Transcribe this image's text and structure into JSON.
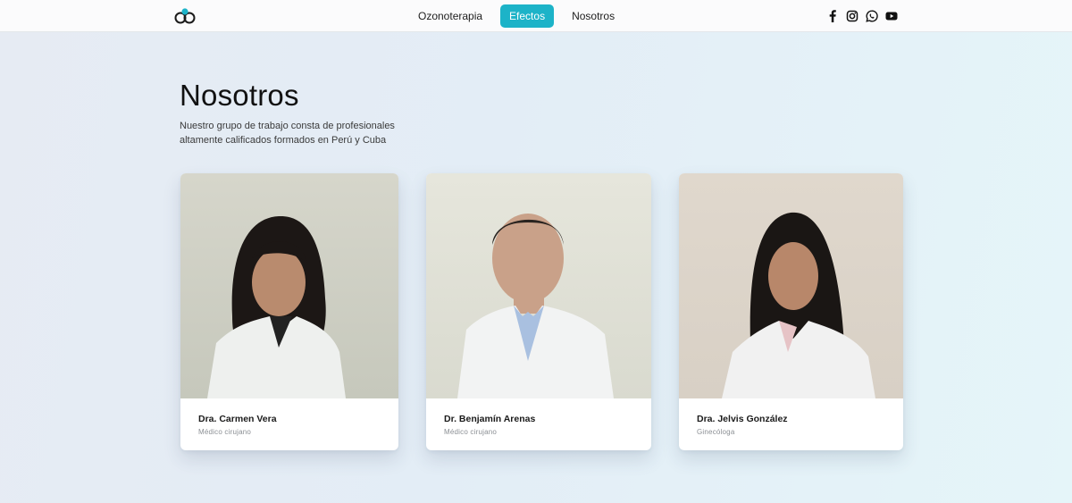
{
  "header": {
    "logo": "logo-icon",
    "nav": [
      {
        "label": "Ozonoterapia",
        "active": false
      },
      {
        "label": "Efectos",
        "active": true
      },
      {
        "label": "Nosotros",
        "active": false
      }
    ],
    "social": [
      "facebook-icon",
      "instagram-icon",
      "whatsapp-icon",
      "youtube-icon"
    ],
    "accent_color": "#1cb3c8"
  },
  "main": {
    "title": "Nosotros",
    "subtitle": "Nuestro grupo de trabajo consta de profesionales altamente calificados formados en Perú y Cuba"
  },
  "team": [
    {
      "name": "Dra. Carmen Vera",
      "role": "Médico cirujano"
    },
    {
      "name": "Dr. Benjamín Arenas",
      "role": "Médico cirujano"
    },
    {
      "name": "Dra. Jelvis González",
      "role": "Ginecóloga"
    }
  ]
}
